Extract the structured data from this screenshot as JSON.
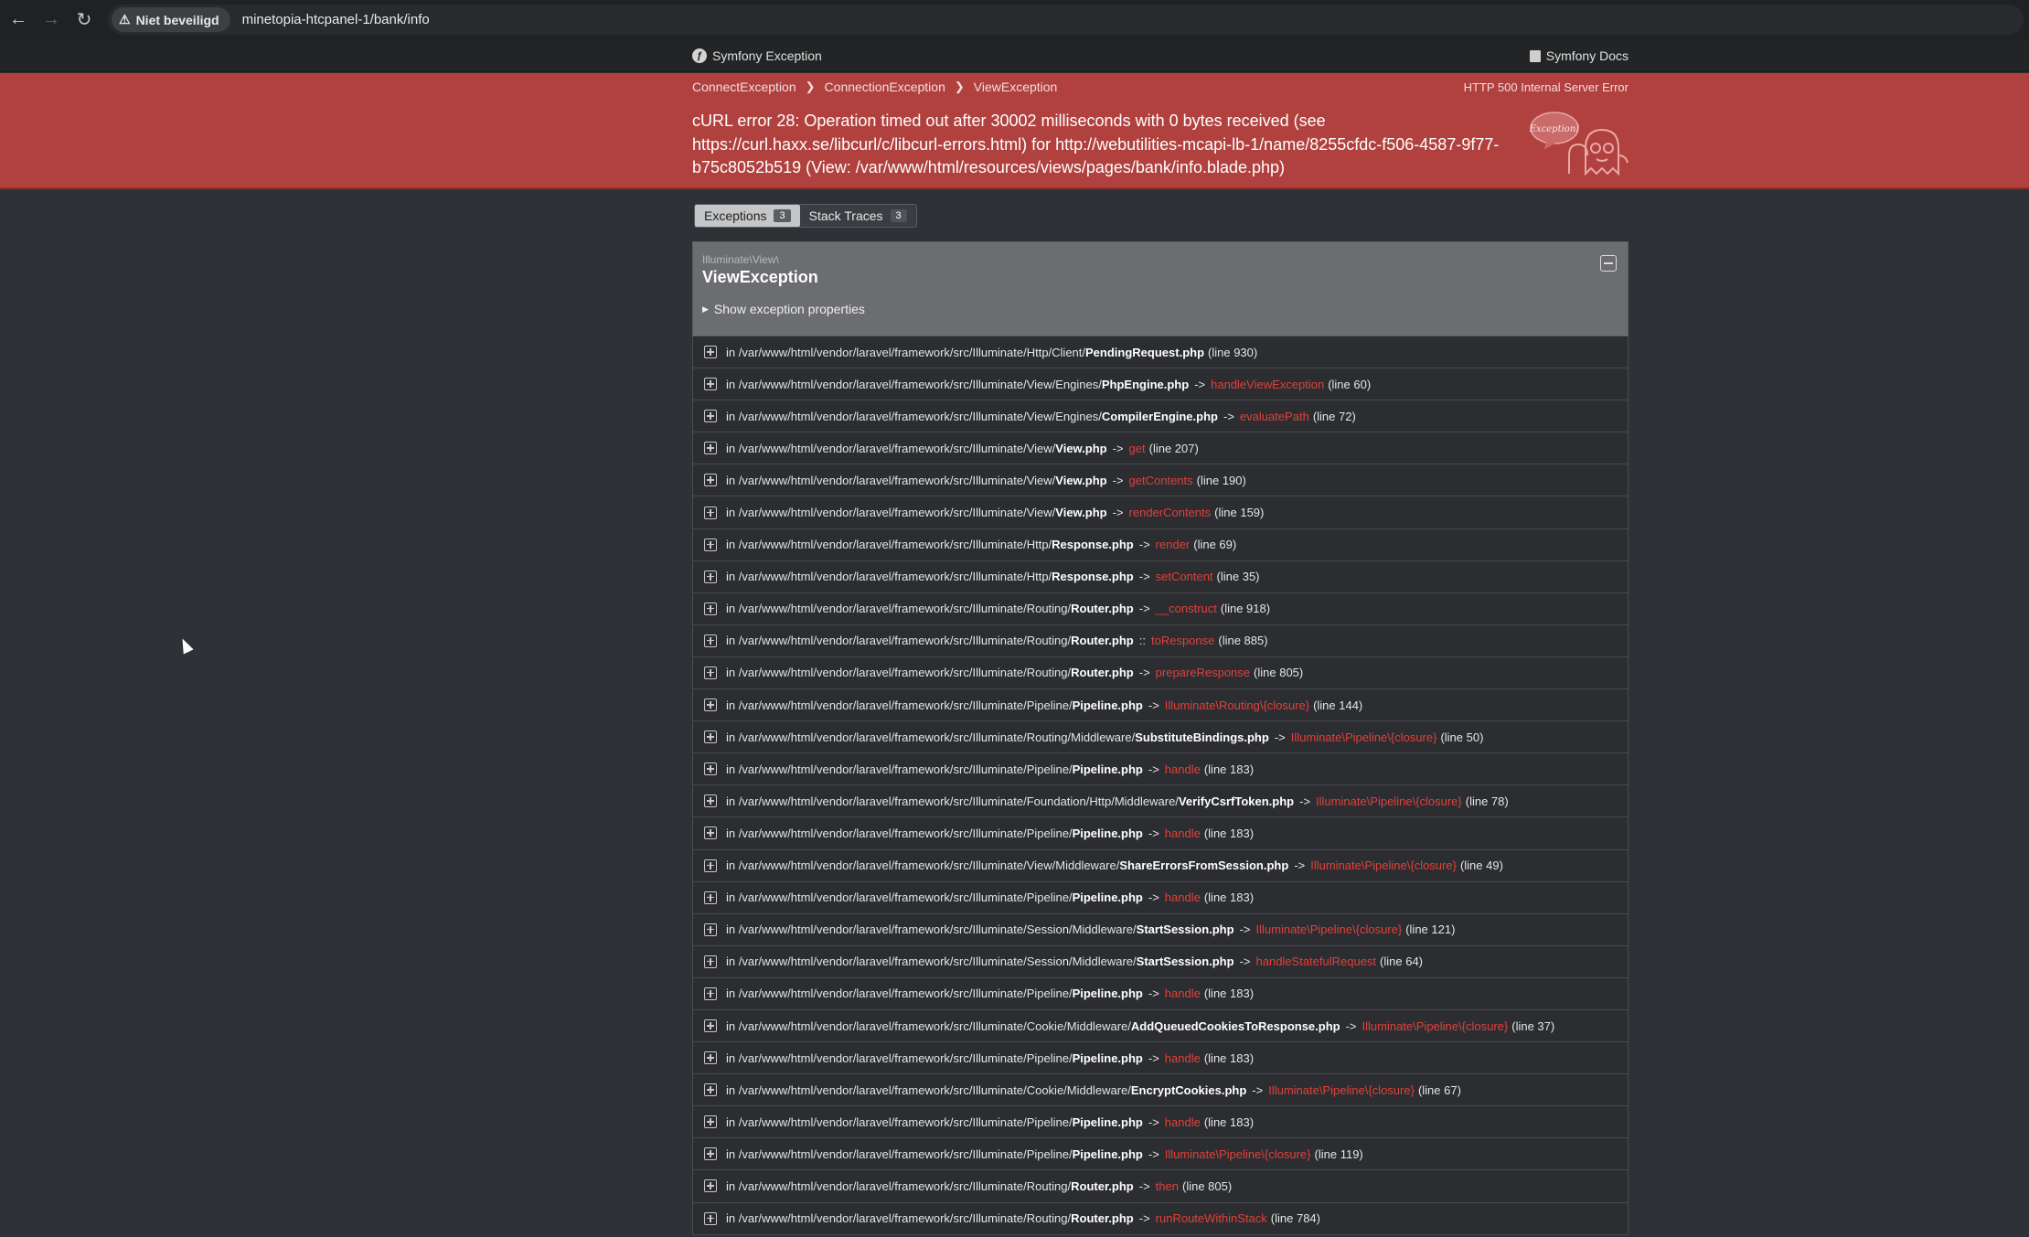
{
  "browser": {
    "security_label": "Niet beveiligd",
    "url": "minetopia-htcpanel-1/bank/info"
  },
  "header": {
    "brand": "Symfony Exception",
    "docs": "Symfony Docs"
  },
  "summary": {
    "crumbs": [
      "ConnectException",
      "ConnectionException",
      "ViewException"
    ],
    "status": "HTTP 500 Internal Server Error",
    "message": "cURL error 28: Operation timed out after 30002 milliseconds with 0 bytes received (see https://curl.haxx.se/libcurl/c/libcurl-errors.html) for http://webutilities-mcapi-lb-1/name/8255cfdc-f506-4587-9f77-b75c8052b519 (View: /var/www/html/resources/views/pages/bank/info.blade.php)",
    "illustration_label": "Exception!"
  },
  "tabs": [
    {
      "label": "Exceptions",
      "count": "3"
    },
    {
      "label": "Stack Traces",
      "count": "3"
    }
  ],
  "trace": {
    "class": "Illuminate\\View\\",
    "title": "ViewException",
    "toggle_label": "Show exception properties",
    "lines": [
      {
        "dir": "in /var/www/html/vendor/laravel/framework/src/Illuminate/Http/Client/",
        "file": "PendingRequest.php",
        "sep": "",
        "fn": "",
        "line": "(line 930)"
      },
      {
        "dir": "in /var/www/html/vendor/laravel/framework/src/Illuminate/View/Engines/",
        "file": "PhpEngine.php",
        "sep": "->",
        "fn": "handleViewException",
        "line": "(line 60)"
      },
      {
        "dir": "in /var/www/html/vendor/laravel/framework/src/Illuminate/View/Engines/",
        "file": "CompilerEngine.php",
        "sep": "->",
        "fn": "evaluatePath",
        "line": "(line 72)"
      },
      {
        "dir": "in /var/www/html/vendor/laravel/framework/src/Illuminate/View/",
        "file": "View.php",
        "sep": "->",
        "fn": "get",
        "line": "(line 207)"
      },
      {
        "dir": "in /var/www/html/vendor/laravel/framework/src/Illuminate/View/",
        "file": "View.php",
        "sep": "->",
        "fn": "getContents",
        "line": "(line 190)"
      },
      {
        "dir": "in /var/www/html/vendor/laravel/framework/src/Illuminate/View/",
        "file": "View.php",
        "sep": "->",
        "fn": "renderContents",
        "line": "(line 159)"
      },
      {
        "dir": "in /var/www/html/vendor/laravel/framework/src/Illuminate/Http/",
        "file": "Response.php",
        "sep": "->",
        "fn": "render",
        "line": "(line 69)"
      },
      {
        "dir": "in /var/www/html/vendor/laravel/framework/src/Illuminate/Http/",
        "file": "Response.php",
        "sep": "->",
        "fn": "setContent",
        "line": "(line 35)"
      },
      {
        "dir": "in /var/www/html/vendor/laravel/framework/src/Illuminate/Routing/",
        "file": "Router.php",
        "sep": "->",
        "fn": "__construct",
        "line": "(line 918)"
      },
      {
        "dir": "in /var/www/html/vendor/laravel/framework/src/Illuminate/Routing/",
        "file": "Router.php",
        "sep": "::",
        "fn": "toResponse",
        "line": "(line 885)"
      },
      {
        "dir": "in /var/www/html/vendor/laravel/framework/src/Illuminate/Routing/",
        "file": "Router.php",
        "sep": "->",
        "fn": "prepareResponse",
        "line": "(line 805)"
      },
      {
        "dir": "in /var/www/html/vendor/laravel/framework/src/Illuminate/Pipeline/",
        "file": "Pipeline.php",
        "sep": "->",
        "fn": "Illuminate\\Routing\\{closure}",
        "line": "(line 144)"
      },
      {
        "dir": "in /var/www/html/vendor/laravel/framework/src/Illuminate/Routing/Middleware/",
        "file": "SubstituteBindings.php",
        "sep": "->",
        "fn": "Illuminate\\Pipeline\\{closure}",
        "line": "(line 50)"
      },
      {
        "dir": "in /var/www/html/vendor/laravel/framework/src/Illuminate/Pipeline/",
        "file": "Pipeline.php",
        "sep": "->",
        "fn": "handle",
        "line": "(line 183)"
      },
      {
        "dir": "in /var/www/html/vendor/laravel/framework/src/Illuminate/Foundation/Http/Middleware/",
        "file": "VerifyCsrfToken.php",
        "sep": "->",
        "fn": "Illuminate\\Pipeline\\{closure}",
        "line": "(line 78)"
      },
      {
        "dir": "in /var/www/html/vendor/laravel/framework/src/Illuminate/Pipeline/",
        "file": "Pipeline.php",
        "sep": "->",
        "fn": "handle",
        "line": "(line 183)"
      },
      {
        "dir": "in /var/www/html/vendor/laravel/framework/src/Illuminate/View/Middleware/",
        "file": "ShareErrorsFromSession.php",
        "sep": "->",
        "fn": "Illuminate\\Pipeline\\{closure}",
        "line": "(line 49)"
      },
      {
        "dir": "in /var/www/html/vendor/laravel/framework/src/Illuminate/Pipeline/",
        "file": "Pipeline.php",
        "sep": "->",
        "fn": "handle",
        "line": "(line 183)"
      },
      {
        "dir": "in /var/www/html/vendor/laravel/framework/src/Illuminate/Session/Middleware/",
        "file": "StartSession.php",
        "sep": "->",
        "fn": "Illuminate\\Pipeline\\{closure}",
        "line": "(line 121)"
      },
      {
        "dir": "in /var/www/html/vendor/laravel/framework/src/Illuminate/Session/Middleware/",
        "file": "StartSession.php",
        "sep": "->",
        "fn": "handleStatefulRequest",
        "line": "(line 64)"
      },
      {
        "dir": "in /var/www/html/vendor/laravel/framework/src/Illuminate/Pipeline/",
        "file": "Pipeline.php",
        "sep": "->",
        "fn": "handle",
        "line": "(line 183)"
      },
      {
        "dir": "in /var/www/html/vendor/laravel/framework/src/Illuminate/Cookie/Middleware/",
        "file": "AddQueuedCookiesToResponse.php",
        "sep": "->",
        "fn": "Illuminate\\Pipeline\\{closure}",
        "line": "(line 37)"
      },
      {
        "dir": "in /var/www/html/vendor/laravel/framework/src/Illuminate/Pipeline/",
        "file": "Pipeline.php",
        "sep": "->",
        "fn": "handle",
        "line": "(line 183)"
      },
      {
        "dir": "in /var/www/html/vendor/laravel/framework/src/Illuminate/Cookie/Middleware/",
        "file": "EncryptCookies.php",
        "sep": "->",
        "fn": "Illuminate\\Pipeline\\{closure}",
        "line": "(line 67)"
      },
      {
        "dir": "in /var/www/html/vendor/laravel/framework/src/Illuminate/Pipeline/",
        "file": "Pipeline.php",
        "sep": "->",
        "fn": "handle",
        "line": "(line 183)"
      },
      {
        "dir": "in /var/www/html/vendor/laravel/framework/src/Illuminate/Pipeline/",
        "file": "Pipeline.php",
        "sep": "->",
        "fn": "Illuminate\\Pipeline\\{closure}",
        "line": "(line 119)"
      },
      {
        "dir": "in /var/www/html/vendor/laravel/framework/src/Illuminate/Routing/",
        "file": "Router.php",
        "sep": "->",
        "fn": "then",
        "line": "(line 805)"
      },
      {
        "dir": "in /var/www/html/vendor/laravel/framework/src/Illuminate/Routing/",
        "file": "Router.php",
        "sep": "->",
        "fn": "runRouteWithinStack",
        "line": "(line 784)"
      }
    ]
  },
  "colors": {
    "summary_bg": "#b0413e",
    "function_name": "#e0413c",
    "page_bg": "#2e3136"
  }
}
